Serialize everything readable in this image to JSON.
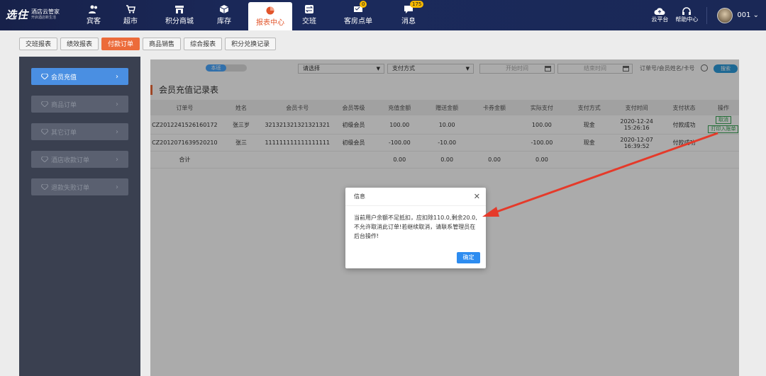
{
  "app": {
    "logo_main": "选住",
    "logo_sub": "酒店云管家",
    "logo_sub2": "开启酒店新生活"
  },
  "nav": [
    {
      "label": "宾客",
      "icon": "guests-icon"
    },
    {
      "label": "超市",
      "icon": "cart-icon"
    },
    {
      "label": "积分商城",
      "icon": "store-icon"
    },
    {
      "label": "库存",
      "icon": "box-icon"
    },
    {
      "label": "报表中心",
      "icon": "pie-chart-icon",
      "active": true
    },
    {
      "label": "交班",
      "icon": "exchange-icon"
    },
    {
      "label": "客房点单",
      "icon": "order-icon",
      "badge": "0"
    },
    {
      "label": "消息",
      "icon": "message-icon",
      "badge": "175"
    }
  ],
  "right_nav": {
    "cloud": "云平台",
    "help": "帮助中心",
    "user": "001"
  },
  "subtabs": [
    "交班报表",
    "绩效报表",
    "付款订单",
    "商品销售",
    "综合报表",
    "积分兑换记录"
  ],
  "subtab_active": "付款订单",
  "sidebar": [
    "会员充值",
    "商品订单",
    "其它订单",
    "酒店收款订单",
    "退款失败订单"
  ],
  "filter": {
    "toggle_on": "本班",
    "toggle_off": "",
    "select1": "请选择",
    "select2": "支付方式",
    "start": "开始时间",
    "end": "结束时间",
    "search_placeholder": "订单号/会员姓名/卡号",
    "search_button": "搜索"
  },
  "section_title": "会员充值记录表",
  "table": {
    "headers": [
      "订单号",
      "姓名",
      "会员卡号",
      "会员等级",
      "充值金额",
      "赠送金额",
      "卡券金额",
      "实际支付",
      "支付方式",
      "支付时间",
      "支付状态",
      "操作"
    ],
    "rows": [
      {
        "order": "CZ2012241526160172",
        "name": "张三岁",
        "card": "321321321321321321",
        "level": "初级会员",
        "amount": "100.00",
        "gift": "10.00",
        "coupon": "",
        "paid": "100.00",
        "method": "现金",
        "time1": "2020-12-24",
        "time2": "15:26:16",
        "status": "付款成功",
        "op1": "取消",
        "op2": "打印入账单"
      },
      {
        "order": "CZ2012071639520210",
        "name": "张三",
        "card": "111111111111111111",
        "level": "初级会员",
        "amount": "-100.00",
        "gift": "-10.00",
        "coupon": "",
        "paid": "-100.00",
        "method": "现金",
        "time1": "2020-12-07",
        "time2": "16:39:52",
        "status": "付款成功"
      }
    ],
    "total": {
      "label": "合计",
      "amount": "0.00",
      "gift": "0.00",
      "coupon": "0.00",
      "paid": "0.00"
    }
  },
  "modal": {
    "title": "信息",
    "message": "当前用户余额不足抵扣，应扣除110.0,剩余20.0,不允许取消此订单!若继续取消，请联系管理员在后台操作!",
    "ok": "确定"
  },
  "colors": {
    "accent": "#ec6b3a",
    "primary": "#2d8cf0",
    "nav_bg": "#1b2a5c",
    "sidebar_bg": "#3a4050",
    "arrow": "#e53a2a"
  }
}
